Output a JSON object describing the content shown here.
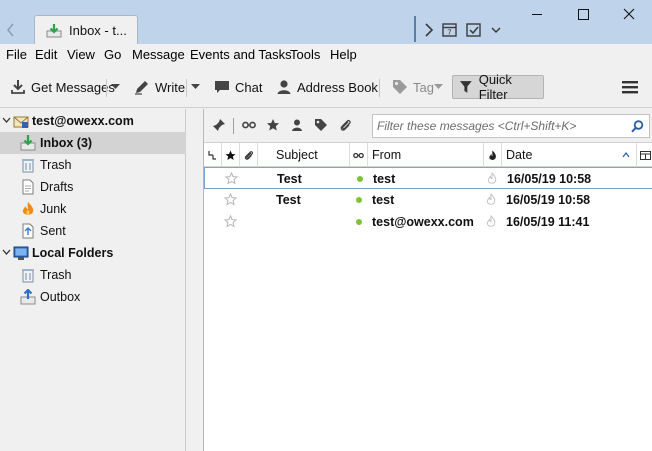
{
  "tabbar": {
    "tab_title": "Inbox - t..."
  },
  "menubar": {
    "items": [
      "File",
      "Edit",
      "View",
      "Go",
      "Message",
      "Events and Tasks",
      "Tools",
      "Help"
    ]
  },
  "toolbar": {
    "get_messages": "Get Messages",
    "write": "Write",
    "chat": "Chat",
    "address_book": "Address Book",
    "tag": "Tag",
    "quick_filter": "Quick Filter"
  },
  "folders": {
    "account": "test@owexx.com",
    "inbox": "Inbox (3)",
    "trash": "Trash",
    "drafts": "Drafts",
    "junk": "Junk",
    "sent": "Sent",
    "local_folders": "Local Folders",
    "local_trash": "Trash",
    "outbox": "Outbox"
  },
  "quickfilter": {
    "search_placeholder": "Filter these messages <Ctrl+Shift+K>"
  },
  "columns": {
    "subject": "Subject",
    "from": "From",
    "date": "Date"
  },
  "messages": [
    {
      "subject": "Test",
      "from": "test",
      "date": "16/05/19 10:58"
    },
    {
      "subject": "Test",
      "from": "test",
      "date": "16/05/19 10:58"
    },
    {
      "subject": "",
      "from": "test@owexx.com",
      "date": "16/05/19 11:41"
    }
  ],
  "colors": {
    "titlebar": "#bfd3ea",
    "online_dot": "#7ec23a",
    "selected_folder": "#d3d3d3"
  }
}
